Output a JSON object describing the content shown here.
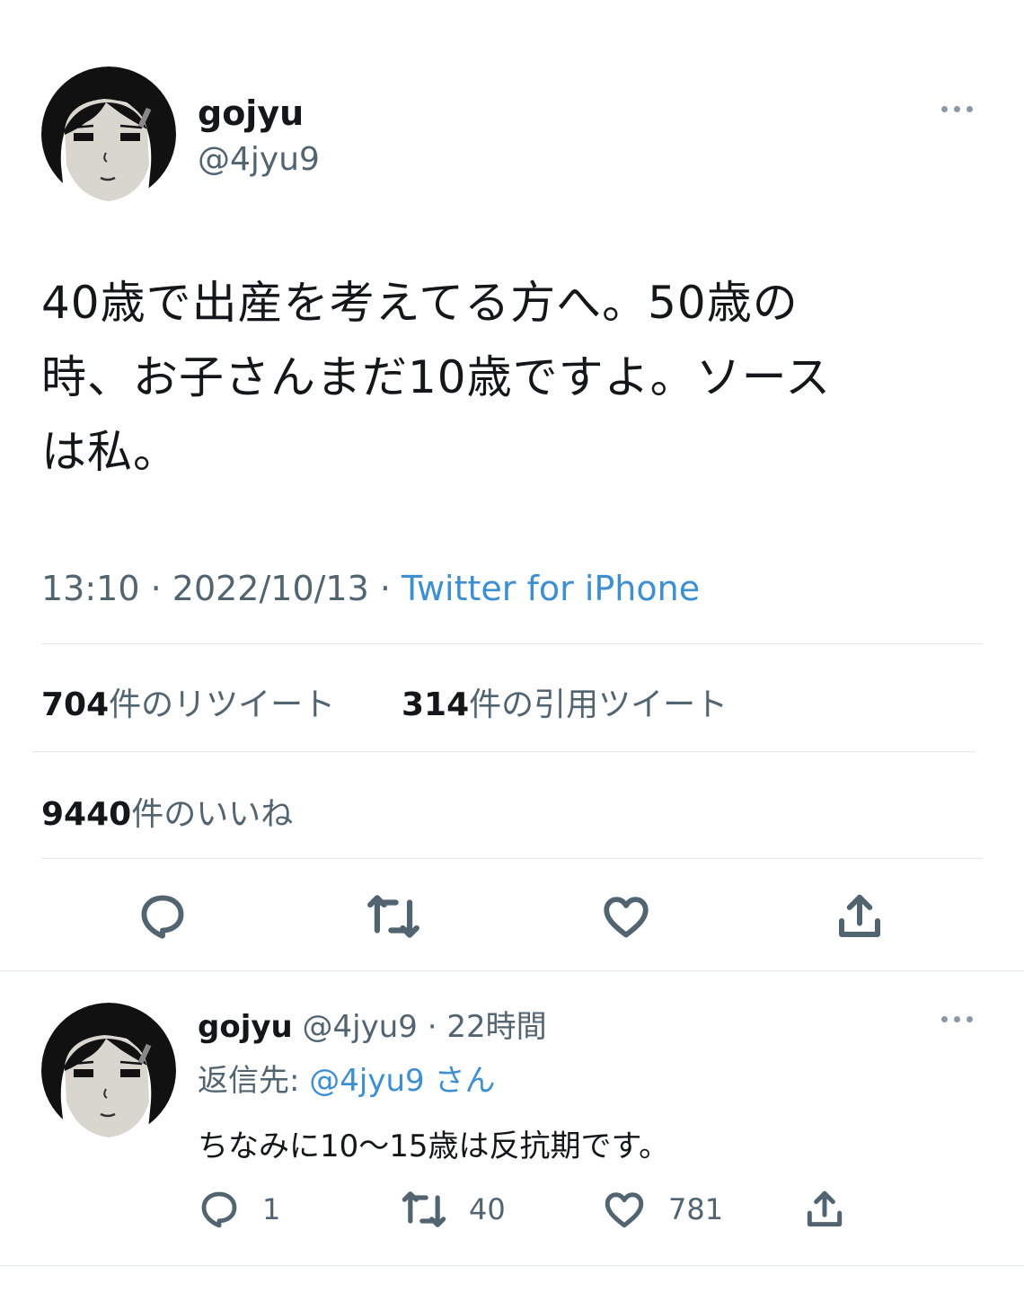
{
  "main_tweet": {
    "avatar_icon": "user-avatar-icon",
    "display_name": "gojyu",
    "handle": "@4jyu9",
    "more_icon": "more-options-icon",
    "text_lines": [
      "40歳で出産を考えてる方へ。50歳の",
      "時、お子さんまだ10歳ですよ。ソース",
      "は私。"
    ],
    "time": "13:10",
    "separator": " · ",
    "date": "2022/10/13",
    "source": "Twitter for iPhone",
    "retweets_count": "704",
    "retweets_label": "件のリツイート",
    "quotes_count": "314",
    "quotes_label": "件の引用ツイート",
    "likes_count": "9440",
    "likes_label": "件のいいね",
    "actions": [
      "reply-icon",
      "retweet-icon",
      "like-icon",
      "share-icon"
    ]
  },
  "reply": {
    "display_name": "gojyu",
    "handle": "@4jyu9",
    "separator": " · ",
    "time_ago": "22時間",
    "reply_to_label": "返信先: ",
    "reply_to_mention": "@4jyu9",
    "reply_to_suffix": "さん",
    "text": "ちなみに10〜15歳は反抗期です。",
    "reply_count": "1",
    "retweet_count": "40",
    "like_count": "781"
  },
  "colors": {
    "text": "#14171a",
    "secondary": "#536471",
    "link": "#3d8fd1",
    "divider": "#e1e6ea"
  }
}
